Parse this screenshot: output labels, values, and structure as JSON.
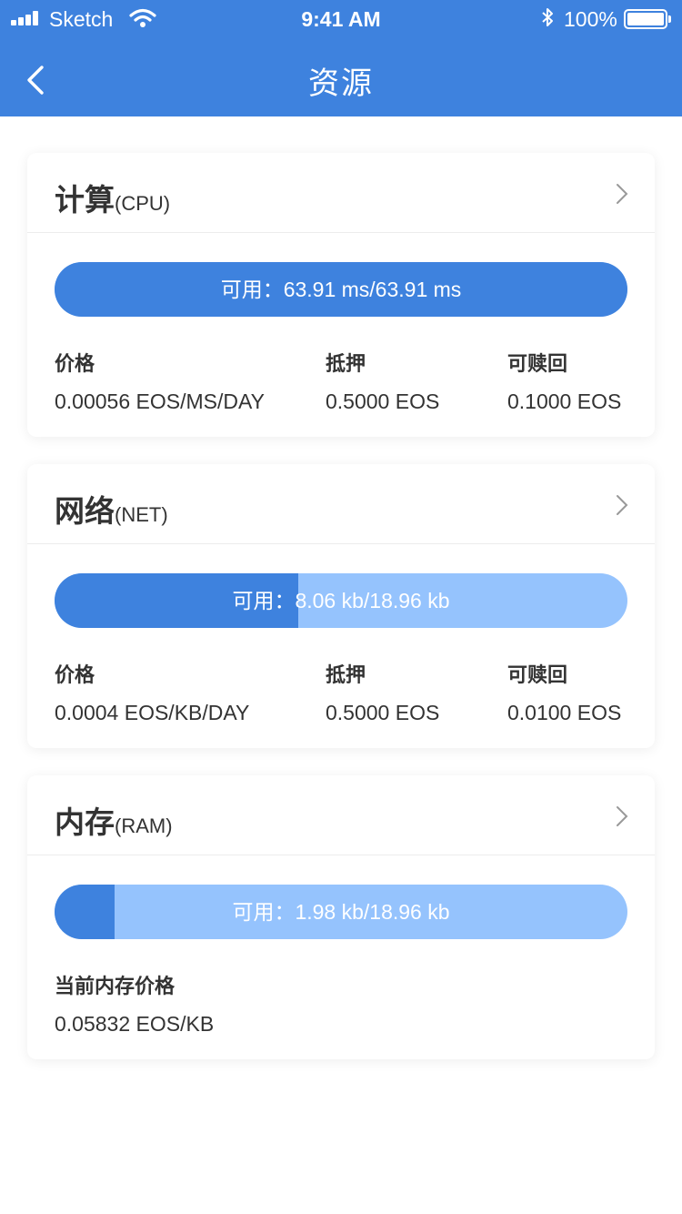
{
  "status_bar": {
    "carrier": "Sketch",
    "time": "9:41 AM",
    "battery": "100%"
  },
  "nav": {
    "title": "资源"
  },
  "colors": {
    "accent": "#3e82de",
    "bar_track": "#95c3fd"
  },
  "cpu": {
    "title": "计算",
    "title_sub": "(CPU)",
    "usage_label": "可用：63.91 ms/63.91 ms",
    "fill_fraction": 1.0,
    "stats": [
      {
        "label": "价格",
        "value": "0.00056 EOS/MS/DAY"
      },
      {
        "label": "抵押",
        "value": "0.5000 EOS"
      },
      {
        "label": "可赎回",
        "value": "0.1000 EOS"
      }
    ]
  },
  "net": {
    "title": "网络",
    "title_sub": "(NET)",
    "usage_label": "可用：8.06 kb/18.96 kb",
    "fill_fraction": 0.425,
    "stats": [
      {
        "label": "价格",
        "value": "0.0004 EOS/KB/DAY"
      },
      {
        "label": "抵押",
        "value": "0.5000 EOS"
      },
      {
        "label": "可赎回",
        "value": "0.0100 EOS"
      }
    ]
  },
  "ram": {
    "title": "内存",
    "title_sub": "(RAM)",
    "usage_label": "可用：1.98 kb/18.96 kb",
    "fill_fraction": 0.104,
    "stats": [
      {
        "label": "当前内存价格",
        "value": "0.05832 EOS/KB"
      }
    ]
  }
}
